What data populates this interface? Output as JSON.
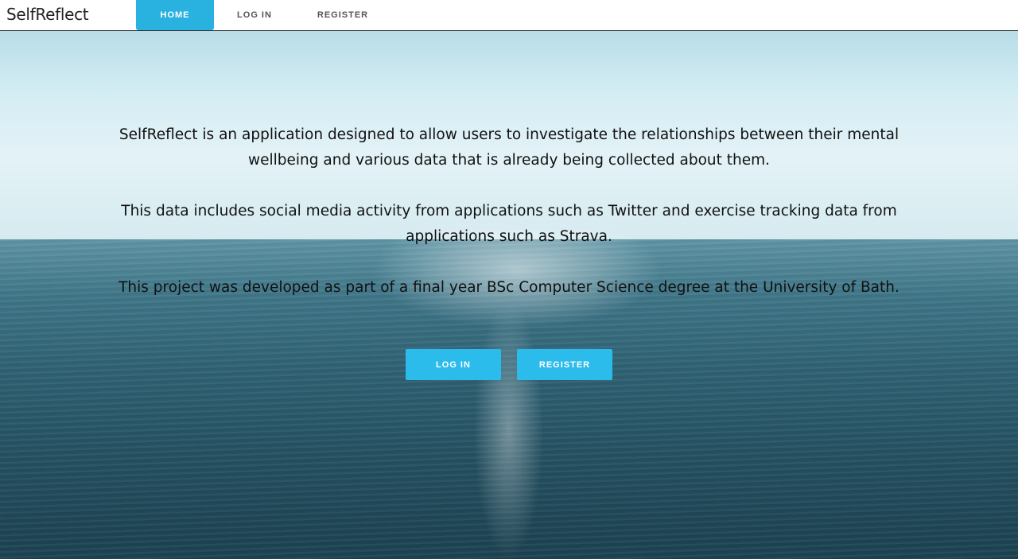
{
  "brand": "SelfReflect",
  "nav": {
    "home": "HOME",
    "login": "LOG IN",
    "register": "REGISTER"
  },
  "hero": {
    "paragraphs": [
      "SelfReflect is an application designed to allow users to investigate the relationships between their mental wellbeing and various data that is already being collected about them.",
      "This data includes social media activity from applications such as Twitter and exercise tracking data from applications such as Strava.",
      "This project was developed as part of a final year BSc Computer Science degree at the University of Bath."
    ],
    "login_button": "LOG IN",
    "register_button": "REGISTER"
  },
  "colors": {
    "accent": "#2cbcec",
    "nav_active": "#29b2e0"
  }
}
